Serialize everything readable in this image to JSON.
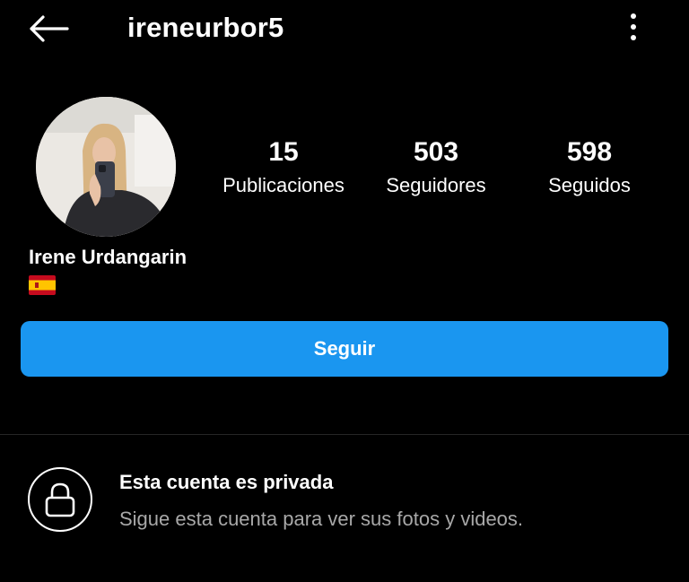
{
  "header": {
    "username": "ireneurbor5",
    "back_icon": "arrow-left-icon",
    "more_icon": "more-vertical-icon"
  },
  "profile": {
    "full_name": "Irene Urdangarin",
    "bio_flag": "🇪🇸",
    "stats": [
      {
        "value": "15",
        "label": "Publicaciones"
      },
      {
        "value": "503",
        "label": "Seguidores"
      },
      {
        "value": "598",
        "label": "Seguidos"
      }
    ]
  },
  "actions": {
    "follow_label": "Seguir",
    "follow_color": "#1a96f0"
  },
  "private_notice": {
    "icon": "lock-icon",
    "title": "Esta cuenta es privada",
    "subtitle": "Sigue esta cuenta para ver sus fotos y videos."
  }
}
